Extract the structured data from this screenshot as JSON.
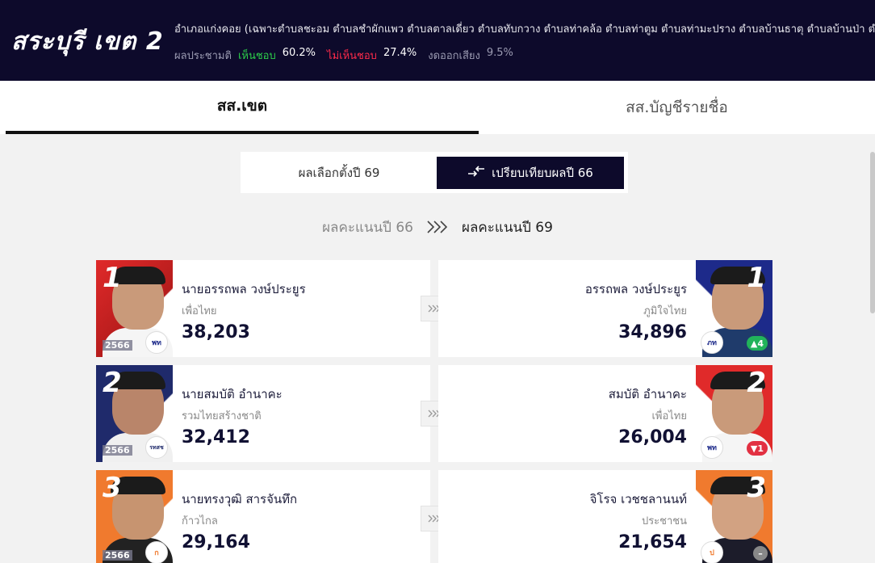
{
  "header": {
    "district": "สระบุรี เขต 2",
    "area": "อำเภอแก่งคอย (เฉพาะตำบลชะอม ตำบลชำผักแพว ตำบลตาลเดี่ยว ตำบลทับกวาง ตำบลท่าคล้อ ตำบลท่าตูม ตำบลท่ามะปราง ตำบลบ้านธาตุ ตำบลบ้านป่า ตำบล",
    "referendum": {
      "label": "ผลประชามติ",
      "agree_label": "เห็นชอบ",
      "agree_value": "60.2%",
      "disagree_label": "ไม่เห็นชอบ",
      "disagree_value": "27.4%",
      "abstain_label": "งดออกเสียง",
      "abstain_value": "9.5%"
    }
  },
  "tabs": {
    "constituency": "สส.เขต",
    "party_list": "สส.บัญชีรายชื่อ"
  },
  "toggle": {
    "result69": "ผลเลือกตั้งปี 69",
    "compare66": "เปรียบเทียบผลปี 66"
  },
  "compare_header": {
    "old": "ผลคะแนนปี 66",
    "new": "ผลคะแนนปี 69"
  },
  "colors": {
    "navy": "#0d0a2b",
    "pheu_thai_red": "#e02a2a",
    "bhumjaithai_blue": "#1d2a8a",
    "ruam_thai_navy": "#1f2a6b",
    "move_forward_orange": "#f07a2e",
    "up_green": "#21b35a",
    "down_red": "#e23042"
  },
  "rows": [
    {
      "left": {
        "rank": "1",
        "year": "2566",
        "name": "นายอรรถพล วงษ์ประยูร",
        "party": "เพื่อไทย",
        "votes": "38,203",
        "logo": "พท",
        "logo_icon": "pheu-thai-logo"
      },
      "right": {
        "rank": "1",
        "name": "อรรถพล วงษ์ประยูร",
        "party": "ภูมิใจไทย",
        "votes": "34,896",
        "logo": "ภท",
        "logo_icon": "bhumjaithai-logo",
        "change": "▲4"
      }
    },
    {
      "left": {
        "rank": "2",
        "year": "2566",
        "name": "นายสมบัติ อำนาคะ",
        "party": "รวมไทยสร้างชาติ",
        "votes": "32,412",
        "logo": "รทสช",
        "logo_icon": "ruam-thai-sang-chart-logo"
      },
      "right": {
        "rank": "2",
        "name": "สมบัติ อำนาคะ",
        "party": "เพื่อไทย",
        "votes": "26,004",
        "logo": "พท",
        "logo_icon": "pheu-thai-logo",
        "change": "▼1"
      }
    },
    {
      "left": {
        "rank": "3",
        "year": "2566",
        "name": "นายทรงวุฒิ สารจันทึก",
        "party": "ก้าวไกล",
        "votes": "29,164",
        "logo": "ก",
        "logo_icon": "move-forward-logo"
      },
      "right": {
        "rank": "3",
        "name": "จิโรจ เวชชลานนท์",
        "party": "ประชาชน",
        "votes": "21,654",
        "logo": "ป",
        "logo_icon": "peoples-party-logo",
        "change": "–"
      }
    }
  ]
}
